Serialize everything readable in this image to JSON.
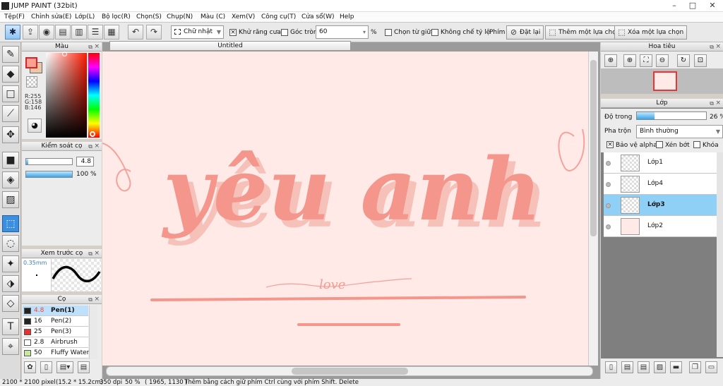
{
  "app": {
    "title": "JUMP PAINT (32bit)"
  },
  "window": {
    "minimize": "–",
    "maximize": "□",
    "close": "✕"
  },
  "menu": [
    "Tệp(F)",
    "Chỉnh sửa(E)",
    "Lớp(L)",
    "Bộ lọc(R)",
    "Chọn(S)",
    "Chụp(N)",
    "Màu (C)",
    "Xem(V)",
    "Công cụ(T)",
    "Cửa sổ(W)",
    "Help"
  ],
  "toolbar": {
    "shape_select": "Chữ nhật",
    "antialias_label": "Khử răng cưa",
    "antialias_checked": true,
    "round_corner_label": "Góc tròn",
    "round_value": "60",
    "percent": "%",
    "center_label": "Chọn từ giữa",
    "ratio_label": "Không chế tỷ lệ",
    "key_label": "Phím",
    "reset_label": "Đặt lại",
    "add_selection_label": "Thêm một lựa chọn",
    "remove_selection_label": "Xóa một lựa chọn"
  },
  "color_panel": {
    "title": "Màu",
    "r": "R:255",
    "g": "G:158",
    "b": "B:146",
    "main_color": "#ff9e92",
    "sub_color": "#e8c8a8"
  },
  "brush_control": {
    "title": "Kiểm soát cọ",
    "size_value": "4.8",
    "size_fill": 0.05,
    "opacity_value": "100 %",
    "opacity_fill": 1.0
  },
  "brush_preview": {
    "title": "Xem trước cọ",
    "size_label": "0.35mm"
  },
  "brushes": {
    "title": "Cọ",
    "items": [
      {
        "size": "4.8",
        "name": "Pen(1)",
        "color": "#222222",
        "selected": true
      },
      {
        "size": "16",
        "name": "Pen(2)",
        "color": "#222222",
        "selected": false
      },
      {
        "size": "25",
        "name": "Pen(3)",
        "color": "#e83030",
        "selected": false
      },
      {
        "size": "2.8",
        "name": "Airbrush",
        "color": "#ffffff",
        "selected": false
      },
      {
        "size": "50",
        "name": "Fluffy Watercolor",
        "color": "#c8e8a0",
        "selected": false
      }
    ]
  },
  "document": {
    "tab": "Untitled",
    "text_main": "yêu  anh",
    "text_small": "love"
  },
  "navigator": {
    "title": "Hoa tiêu"
  },
  "layer_panel": {
    "title": "Lớp",
    "opacity_label": "Độ trong",
    "opacity_value": "26 %",
    "opacity_fill": 0.26,
    "blend_label": "Pha trộn",
    "blend_value": "Bình thường",
    "protect_alpha": "Bảo vệ alpha",
    "clip_label": "Xén bớt",
    "lock_label": "Khóa",
    "layers": [
      {
        "name": "Lớp1",
        "selected": false
      },
      {
        "name": "Lớp4",
        "selected": false
      },
      {
        "name": "Lớp3",
        "selected": true
      },
      {
        "name": "Lớp2",
        "selected": false
      }
    ]
  },
  "status": {
    "size": "2100 * 2100 pixel",
    "cm": "(15.2 * 15.2cm)",
    "dpi": "350 dpi",
    "zoom": "50 %",
    "coords": "( 1965, 1130 )",
    "hint": "Thêm bằng cách giữ phím Ctrl cùng với phím Shift. Delete"
  }
}
